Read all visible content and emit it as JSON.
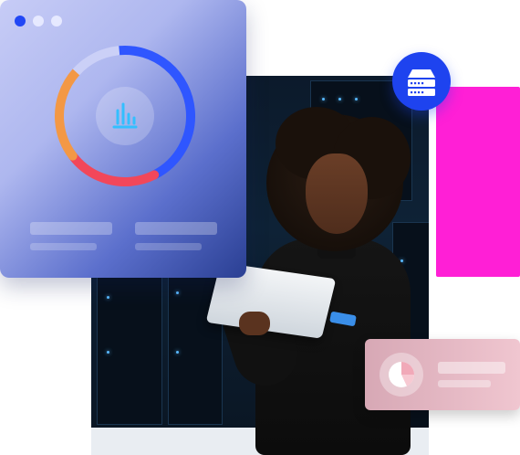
{
  "window_dots": [
    "primary",
    "secondary",
    "tertiary"
  ],
  "donut_chart": {
    "segments": [
      {
        "name": "blue",
        "color": "#2f56ff",
        "fraction": 0.44
      },
      {
        "name": "red",
        "color": "#f2475a",
        "fraction": 0.22
      },
      {
        "name": "orange",
        "color": "#f39845",
        "fraction": 0.22
      },
      {
        "name": "track",
        "color": "#cbd0f7",
        "fraction": 0.12
      }
    ],
    "center_icon": "bar-chart-icon"
  },
  "badge": {
    "icon": "server-icon",
    "color": "#1e43ef"
  },
  "mini_card": {
    "icon": "pie-chart-icon"
  },
  "accent_colors": {
    "magenta": "#ff1fd6",
    "blue": "#2147f5",
    "pink": "#e8bac6"
  }
}
